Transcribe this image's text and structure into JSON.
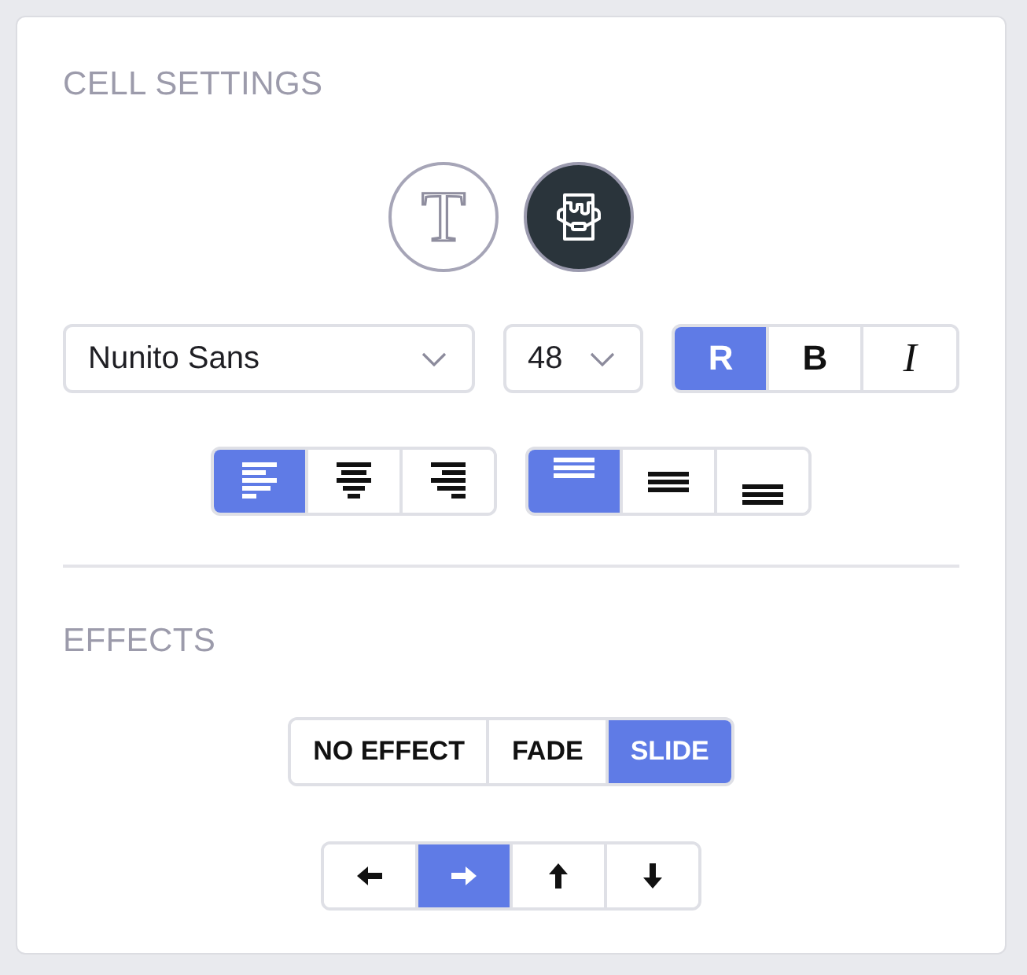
{
  "panel": {
    "title": "CELL SETTINGS"
  },
  "modes": [
    {
      "kind": "text",
      "label": "T",
      "selected": false
    },
    {
      "kind": "fill",
      "selected": true
    }
  ],
  "font": {
    "family": "Nunito Sans",
    "size": "48"
  },
  "styles": [
    {
      "kind": "regular",
      "label": "R",
      "selected": true
    },
    {
      "kind": "bold",
      "label": "B",
      "selected": false
    },
    {
      "kind": "italic",
      "label": "I",
      "selected": false
    }
  ],
  "horizontal_align": [
    {
      "kind": "left",
      "selected": true
    },
    {
      "kind": "center",
      "selected": false
    },
    {
      "kind": "right",
      "selected": false
    }
  ],
  "vertical_align": [
    {
      "kind": "top",
      "selected": true
    },
    {
      "kind": "middle",
      "selected": false
    },
    {
      "kind": "bottom",
      "selected": false
    }
  ],
  "effects": {
    "title": "EFFECTS",
    "options": [
      {
        "label": "NO EFFECT",
        "selected": false
      },
      {
        "label": "FADE",
        "selected": false
      },
      {
        "label": "SLIDE",
        "selected": true
      }
    ],
    "directions": [
      {
        "kind": "left",
        "selected": false
      },
      {
        "kind": "right",
        "selected": true
      },
      {
        "kind": "up",
        "selected": false
      },
      {
        "kind": "down",
        "selected": false
      }
    ]
  }
}
